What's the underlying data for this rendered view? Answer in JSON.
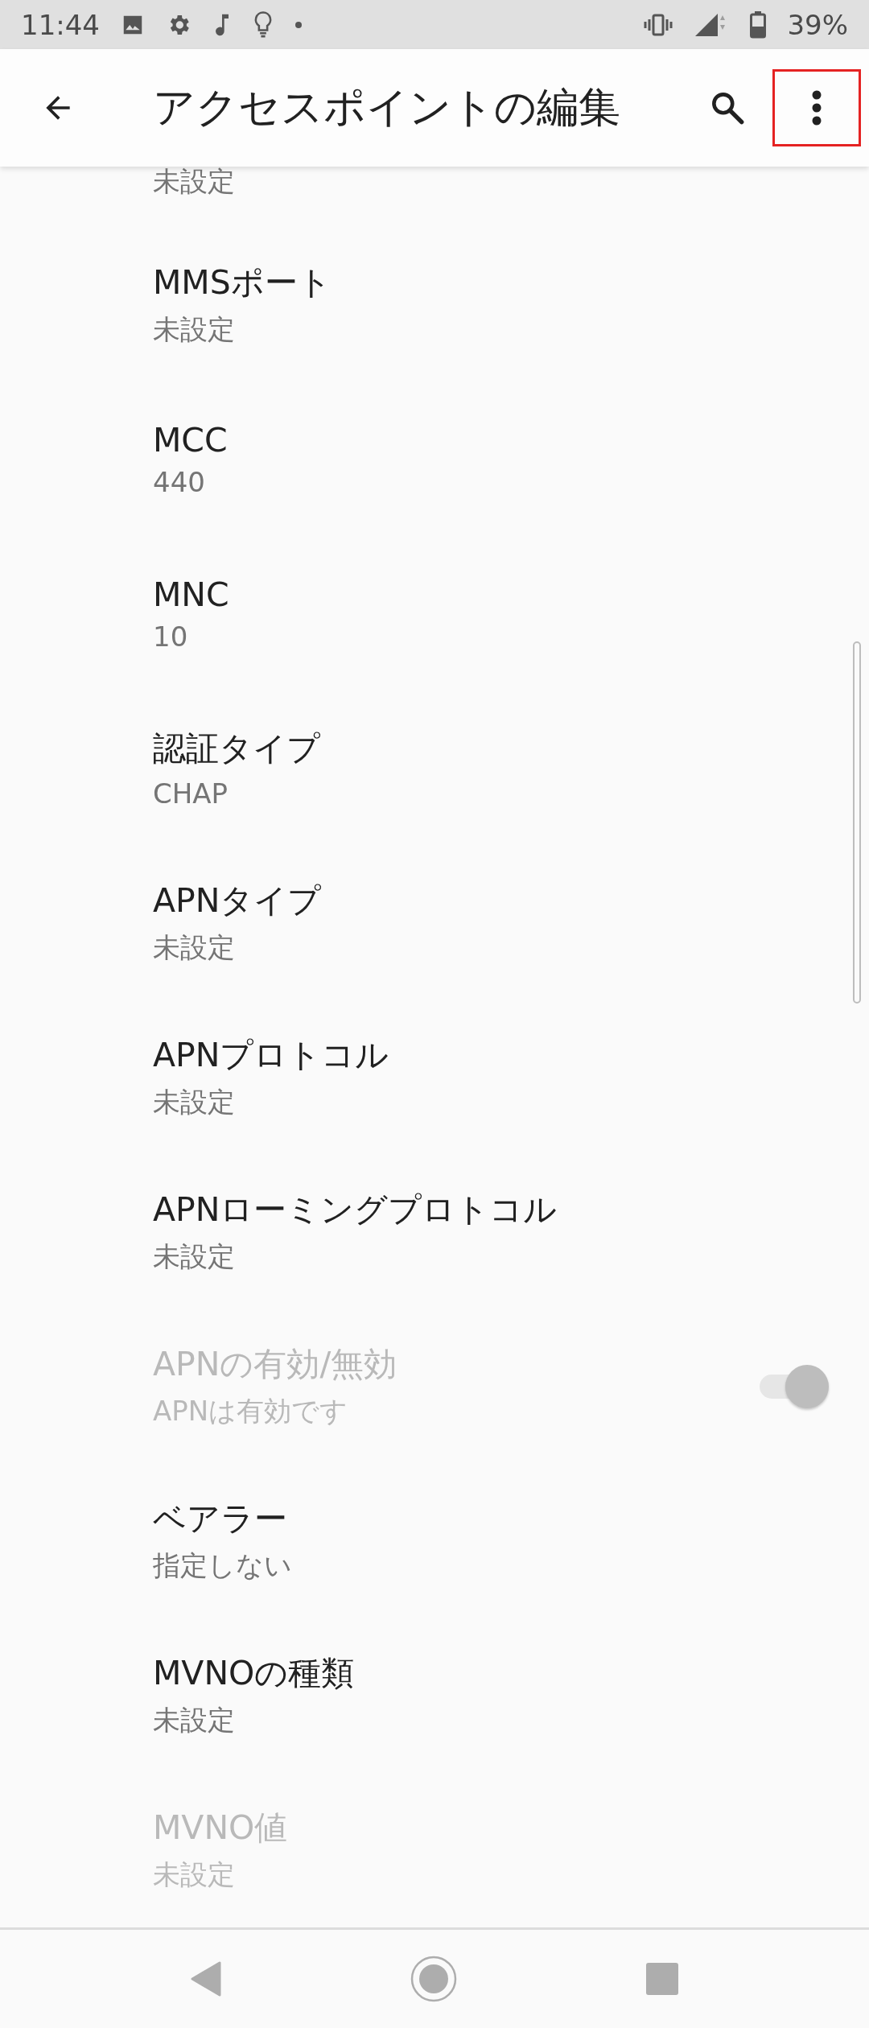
{
  "status_bar": {
    "time": "11:44",
    "battery": "39%"
  },
  "toolbar": {
    "title": "アクセスポイントの編集",
    "menu_highlighted": true
  },
  "top_partial_summary": "未設定",
  "items": [
    {
      "kind": "text",
      "title": "MMSポート",
      "summary": "未設定",
      "disabled": false
    },
    {
      "kind": "text",
      "title": "MCC",
      "summary": "440",
      "disabled": false
    },
    {
      "kind": "text",
      "title": "MNC",
      "summary": "10",
      "disabled": false
    },
    {
      "kind": "text",
      "title": "認証タイプ",
      "summary": "CHAP",
      "disabled": false
    },
    {
      "kind": "text",
      "title": "APNタイプ",
      "summary": "未設定",
      "disabled": false
    },
    {
      "kind": "text",
      "title": "APNプロトコル",
      "summary": "未設定",
      "disabled": false
    },
    {
      "kind": "text",
      "title": "APNローミングプロトコル",
      "summary": "未設定",
      "disabled": false
    },
    {
      "kind": "toggle",
      "title": "APNの有効/無効",
      "summary": "APNは有効です",
      "disabled": true,
      "checked": true
    },
    {
      "kind": "text",
      "title": "ベアラー",
      "summary": "指定しない",
      "disabled": false
    },
    {
      "kind": "text",
      "title": "MVNOの種類",
      "summary": "未設定",
      "disabled": false
    },
    {
      "kind": "text",
      "title": "MVNO値",
      "summary": "未設定",
      "disabled": true
    }
  ]
}
